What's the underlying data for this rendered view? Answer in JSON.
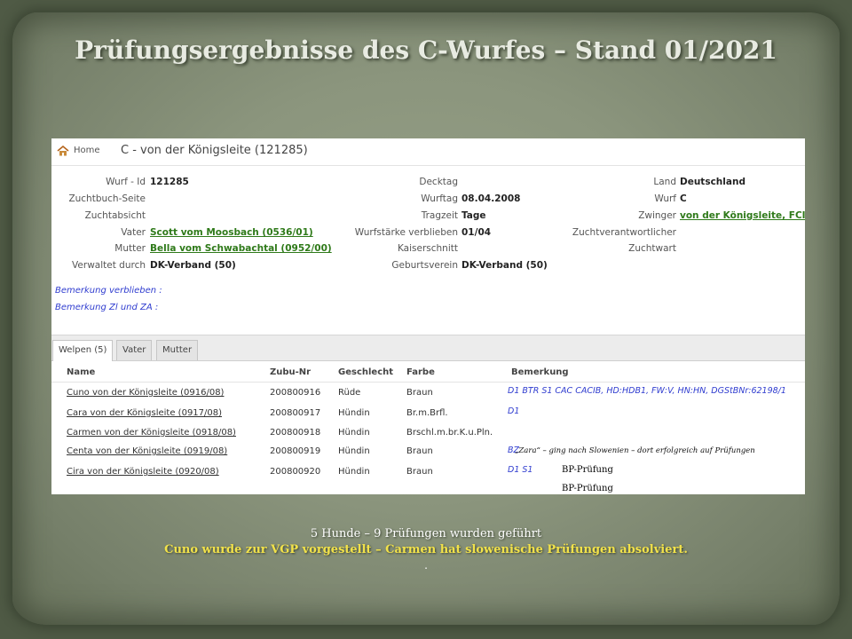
{
  "slide": {
    "title": "Prüfungsergebnisse des C-Wurfes – Stand 01/2021",
    "footer_line1": "5 Hunde – 9 Prüfungen wurden geführt",
    "footer_line2": "Cuno wurde zur VGP vorgestellt – Carmen hat slowenische Prüfungen absolviert.",
    "footer_line3": "."
  },
  "header": {
    "home_label": "Home",
    "litter_title": "C - von der Königsleite (121285)"
  },
  "details": {
    "wurf_id_label": "Wurf - Id",
    "wurf_id": "121285",
    "zuchtbuch_label": "Zuchtbuch-Seite",
    "zuchtabsicht_label": "Zuchtabsicht",
    "vater_label": "Vater",
    "vater": "Scott vom Moosbach (0536/01)",
    "mutter_label": "Mutter",
    "mutter": "Bella vom Schwabachtal (0952/00)",
    "verwaltet_label": "Verwaltet durch",
    "verwaltet": "DK-Verband (50)",
    "decktag_label": "Decktag",
    "wurftag_label": "Wurftag",
    "wurftag": "08.04.2008",
    "tragzeit_label": "Tragzeit",
    "tragzeit": "Tage",
    "wurfstaerke_label": "Wurfstärke verblieben",
    "wurfstaerke": "01/04",
    "kaiserschnitt_label": "Kaiserschnitt",
    "geburtsverein_label": "Geburtsverein",
    "geburtsverein": "DK-Verband (50)",
    "land_label": "Land",
    "land": "Deutschland",
    "wurf_label": "Wurf",
    "wurf": "C",
    "zwinger_label": "Zwinger",
    "zwinger": "von der Königsleite, FCI (",
    "zuchtverantwortlicher_label": "Zuchtverantwortlicher",
    "zuchtwart_label": "Zuchtwart"
  },
  "remarks": {
    "verblieben": "Bemerkung verblieben :",
    "zl_za": "Bemerkung Zl und ZA :"
  },
  "tabs": [
    {
      "label": "Welpen (5)",
      "active": true
    },
    {
      "label": "Vater",
      "active": false
    },
    {
      "label": "Mutter",
      "active": false
    }
  ],
  "table": {
    "columns": [
      "Name",
      "Zubu-Nr",
      "Geschlecht",
      "Farbe",
      "Bemerkung"
    ],
    "rows": [
      {
        "name": "Cuno von der Königsleite (0916/08)",
        "zubu": "200800916",
        "geschlecht": "Rüde",
        "farbe": "Braun",
        "bemerkung": "D1 BTR S1 CAC CACIB, HD:HDB1, FW:V, HN:HN, DGStBNr:62198/1"
      },
      {
        "name": "Cara von der Königsleite (0917/08)",
        "zubu": "200800917",
        "geschlecht": "Hündin",
        "farbe": "Br.m.Brfl.",
        "bemerkung": "D1"
      },
      {
        "name": "Carmen von der Königsleite (0918/08)",
        "zubu": "200800918",
        "geschlecht": "Hündin",
        "farbe": "Brschl.m.br.K.u.Pln.",
        "bemerkung": ""
      },
      {
        "name": "Centa von der Königsleite (0919/08)",
        "zubu": "200800919",
        "geschlecht": "Hündin",
        "farbe": "Braun",
        "bemerkung": "BZ"
      },
      {
        "name": "Cira von der Königsleite (0920/08)",
        "zubu": "200800920",
        "geschlecht": "Hündin",
        "farbe": "Braun",
        "bemerkung": "D1 S1"
      }
    ]
  },
  "annotations": {
    "carmen_note": "„Zara“ – ging nach Slowenien – dort erfolgreich auf Prüfungen",
    "bp1": "BP-Prüfung",
    "bp2": "BP-Prüfung"
  },
  "colors": {
    "link_green": "#2f7a1a",
    "remark_blue": "#2f3ccf",
    "footer_yellow": "#f2e24a"
  }
}
